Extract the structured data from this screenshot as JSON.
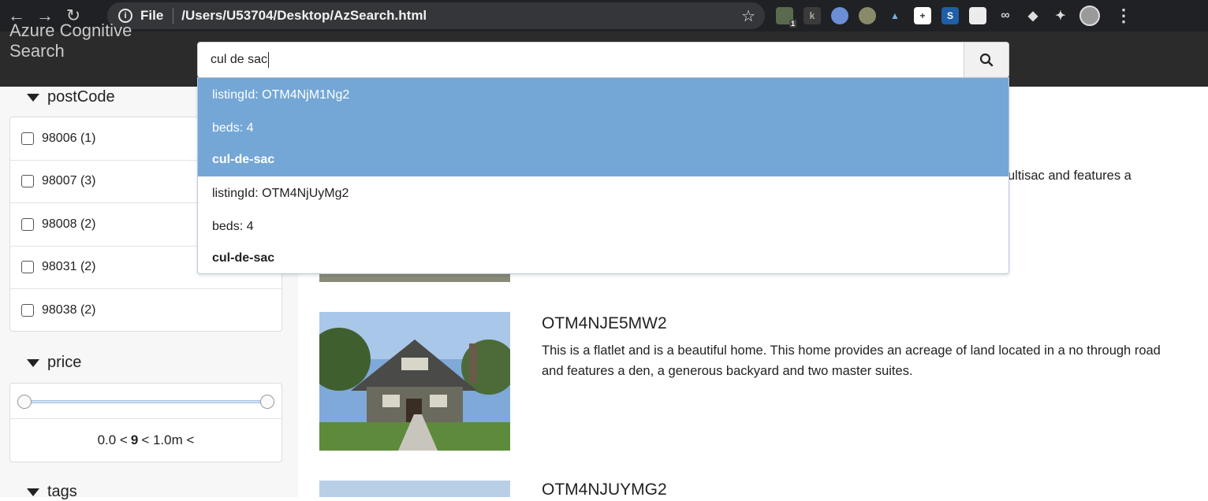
{
  "browser": {
    "scheme_label": "File",
    "url": "/Users/U53704/Desktop/AzSearch.html",
    "extension_badge": "1"
  },
  "app": {
    "brand_line1": "Azure Cognitive",
    "brand_line2": "Search"
  },
  "search": {
    "query": "cul de sac"
  },
  "suggestions": [
    {
      "listing": "listingId: OTM4NjM1Ng2",
      "beds": "beds: 4",
      "feature": "cul-de-sac",
      "highlighted": true
    },
    {
      "listing": "listingId: OTM4NjUyMg2",
      "beds": "beds: 4",
      "feature": "cul-de-sac",
      "highlighted": false
    }
  ],
  "facets": {
    "postcode": {
      "title": "postCode",
      "items": [
        {
          "label": "98006 (1)"
        },
        {
          "label": "98007 (3)"
        },
        {
          "label": "98008 (2)"
        },
        {
          "label": "98031 (2)"
        },
        {
          "label": "98038 (2)"
        }
      ]
    },
    "price": {
      "title": "price",
      "range_min": "0.0 <",
      "range_value": "9",
      "range_max": "< 1.0m <"
    },
    "tags": {
      "title": "tags"
    }
  },
  "results": [
    {
      "title": "",
      "partial_desc": "ultisac and features a"
    },
    {
      "title": "OTM4NJE5MW2",
      "description": "This is a flatlet and is a beautiful home. This home provides an acreage of land located in a no through road and features a den, a generous backyard and two master suites."
    },
    {
      "title": "OTM4NJUYMG2"
    }
  ],
  "colors": {
    "highlight": "#74a7d6",
    "header": "#2b2b2b"
  }
}
